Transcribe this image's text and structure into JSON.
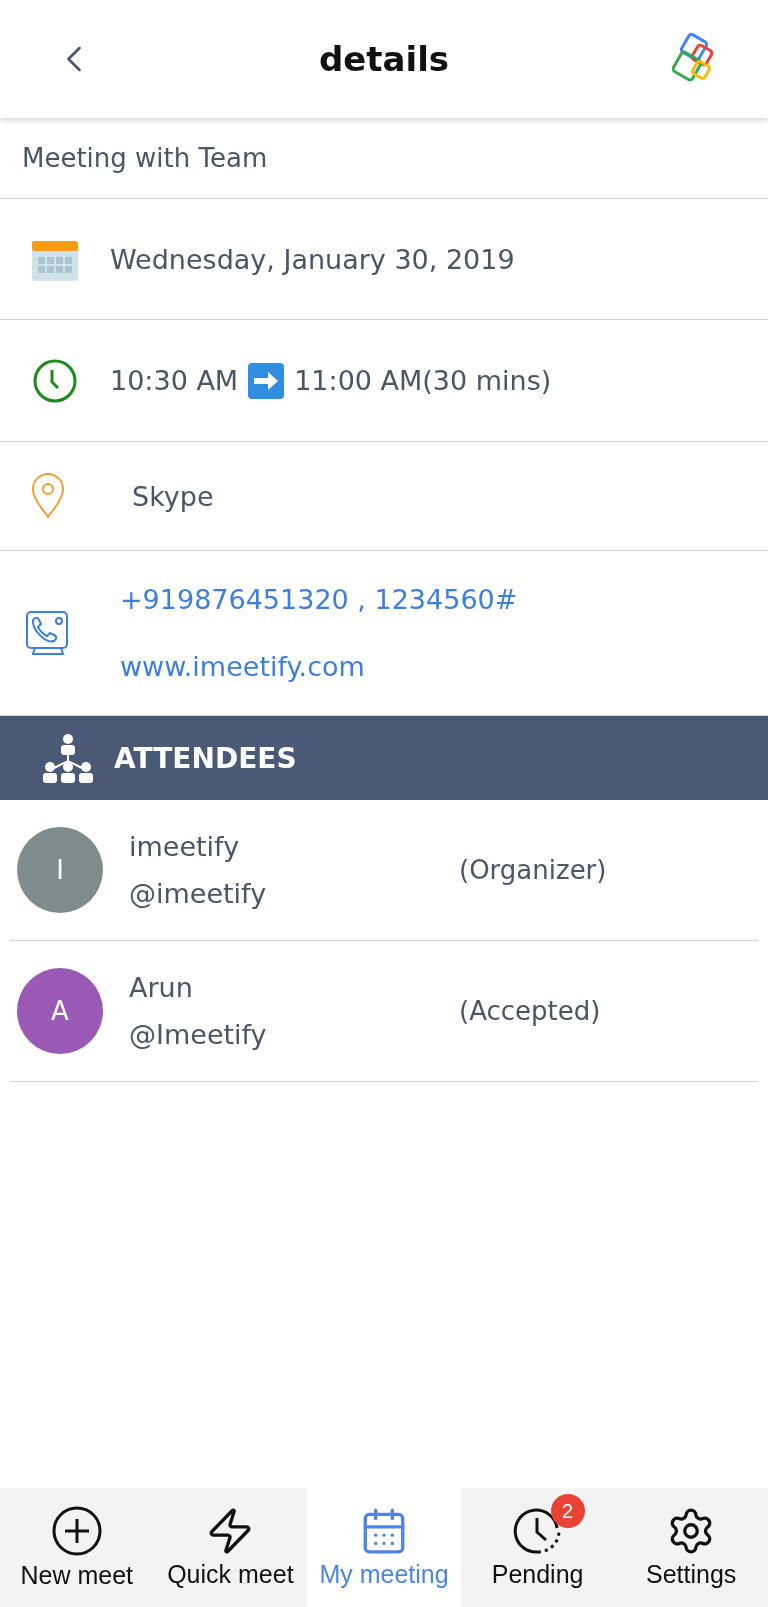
{
  "header": {
    "title": "details"
  },
  "meeting": {
    "title": "Meeting with Team",
    "date": "Wednesday, January 30, 2019",
    "start_time": "10:30 AM",
    "end_time": "11:00 AM(30 mins)",
    "location": "Skype",
    "phone": "+919876451320 , 1234560#",
    "website": "www.imeetify.com"
  },
  "attendees_header": "ATTENDEES",
  "attendees": [
    {
      "initial": "I",
      "name": "imeetify",
      "handle": "@imeetify",
      "status": "(Organizer)",
      "color": "#7f8c8d"
    },
    {
      "initial": "A",
      "name": "Arun",
      "handle": "@Imeetify",
      "status": "(Accepted)",
      "color": "#9b59b6"
    }
  ],
  "nav": [
    {
      "kind": "plus",
      "label": "New meet",
      "selected": false
    },
    {
      "kind": "bolt",
      "label": "Quick meet",
      "selected": false
    },
    {
      "kind": "calendar",
      "label": "My meeting",
      "selected": true
    },
    {
      "kind": "clock",
      "label": "Pending",
      "selected": false,
      "badge": "2"
    },
    {
      "kind": "gear",
      "label": "Settings",
      "selected": false
    }
  ]
}
